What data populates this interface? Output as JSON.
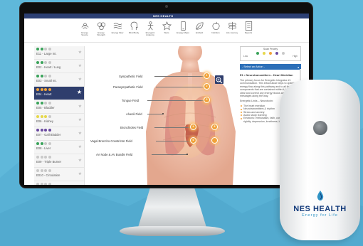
{
  "app": {
    "logo_text": "NES HEALTH"
  },
  "toolbar": {
    "items": [
      {
        "label": "Energy Source",
        "icon": "hands-icon"
      },
      {
        "label": "Energy Strength",
        "icon": "circles-icon"
      },
      {
        "label": "Energy Flow",
        "icon": "flow-icon"
      },
      {
        "label": "Mind Body",
        "icon": "head-icon"
      },
      {
        "label": "Energetic Anatomy",
        "icon": "figure-icon"
      },
      {
        "label": "Stars",
        "icon": "star-icon"
      },
      {
        "label": "Energy Maps",
        "icon": "phone-icon"
      },
      {
        "label": "Emfield",
        "icon": "leaf-icon"
      },
      {
        "label": "Nutrition",
        "icon": "apple-icon"
      },
      {
        "label": "Life Journey",
        "icon": "signpost-icon"
      },
      {
        "label": "Reports",
        "icon": "document-icon"
      }
    ]
  },
  "sidebar": {
    "items": [
      {
        "label": "E11 - Large Int.",
        "dots": [
          "#3aa35a",
          "#3aa35a",
          "#c9c9c9",
          "#c9c9c9"
        ]
      },
      {
        "label": "E02 - Heart / Lung",
        "dots": [
          "#3aa35a",
          "#3aa35a",
          "#c9c9c9",
          "#c9c9c9"
        ]
      },
      {
        "label": "E03 - Small Int.",
        "dots": [
          "#3aa35a",
          "#3aa35a",
          "#c9c9c9",
          "#c9c9c9"
        ]
      },
      {
        "label": "E04 - Heart",
        "dots": [
          "#f1a33a",
          "#f1a33a",
          "#f1a33a",
          "#f1a33a"
        ],
        "active": true
      },
      {
        "label": "E05 - Bladder",
        "dots": [
          "#3aa35a",
          "#3aa35a",
          "#c9c9c9",
          "#c9c9c9"
        ]
      },
      {
        "label": "E06 - Kidney",
        "dots": [
          "#e6d84a",
          "#e6d84a",
          "#e6d84a",
          "#c9c9c9"
        ]
      },
      {
        "label": "E07 - Gall Bladder",
        "dots": [
          "#6a4aa0",
          "#6a4aa0",
          "#6a4aa0",
          "#6a4aa0"
        ]
      },
      {
        "label": "E08 - Liver",
        "dots": [
          "#3aa35a",
          "#3aa35a",
          "#c9c9c9",
          "#c9c9c9"
        ]
      },
      {
        "label": "E09 - Triple Burner",
        "dots": [
          "#c9c9c9",
          "#c9c9c9",
          "#c9c9c9",
          "#c9c9c9"
        ]
      },
      {
        "label": "E010 - Circulation",
        "dots": [
          "#c9c9c9",
          "#c9c9c9",
          "#c9c9c9",
          "#c9c9c9"
        ]
      },
      {
        "label": "E011 - Stomach",
        "dots": [
          "#c9c9c9",
          "#c9c9c9",
          "#c9c9c9",
          "#c9c9c9"
        ]
      }
    ]
  },
  "fields": [
    {
      "label": "Sympathetic Field",
      "node": "1"
    },
    {
      "label": "Parasympathetic Field",
      "node": "2"
    },
    {
      "label": "Tongue Field",
      "node": "3"
    },
    {
      "label": "Alveoli Field",
      "node": ""
    },
    {
      "label": "Bronchioles Field",
      "node": "4"
    },
    {
      "label": "Vagal Broncho Constrictor Field",
      "node": "5"
    },
    {
      "label": "AV Node & AV Bundle Field",
      "node": "6"
    }
  ],
  "panel": {
    "scale": {
      "title": "Scan Priority",
      "low": "Low",
      "high": "High",
      "colors": [
        "#3aa35a",
        "#e6d84a",
        "#f1a33a",
        "#6a4aa0",
        "#c9c9c9"
      ]
    },
    "action_label": "- Select an Action -",
    "title": "E1 • Neurotransmitters - Heart Meridian",
    "paragraphs": [
      "The primary focus for Energetic Integrator #1 communication. This infoceutical helps to optimize energy flow along this pathway and to all the components that are contained within it, helping to clear and correct any energy blocks and misalignment messages along the way.",
      "Energetic Links – Neurotoxin:"
    ],
    "list": [
      "The heart meridian",
      "Neurotransmitters & rhythm",
      "Stress and anxiety",
      "Audio study learning",
      "Emotions: enthusiasm, faith, compassion, flexibility rigidity, depression, loneliness, love, forgiveness"
    ]
  },
  "device": {
    "brand": "NES HEALTH",
    "tagline": "Energy for Life"
  }
}
